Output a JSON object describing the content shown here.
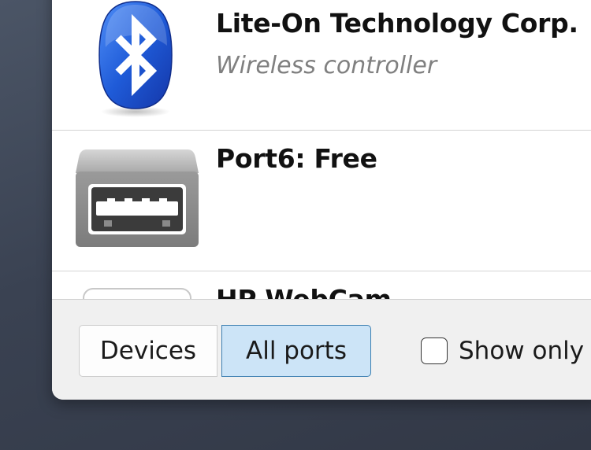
{
  "devices": [
    {
      "title": "Lite-On Technology Corp.",
      "subtitle": "Wireless controller",
      "icon": "bluetooth-icon"
    },
    {
      "title": "Port6: Free",
      "subtitle": "",
      "icon": "usb-port-icon"
    },
    {
      "title": "HP WebCam",
      "subtitle": "",
      "icon": "webcam-icon"
    }
  ],
  "footer": {
    "devices_label": "Devices",
    "all_ports_label": "All ports",
    "show_only_label": "Show only",
    "show_only_checked": false
  },
  "colors": {
    "bluetooth_blue": "#1f5bd8",
    "selected_button_bg": "#cce4f7",
    "selected_button_border": "#3c7fb1",
    "subtitle_gray": "#808080"
  }
}
